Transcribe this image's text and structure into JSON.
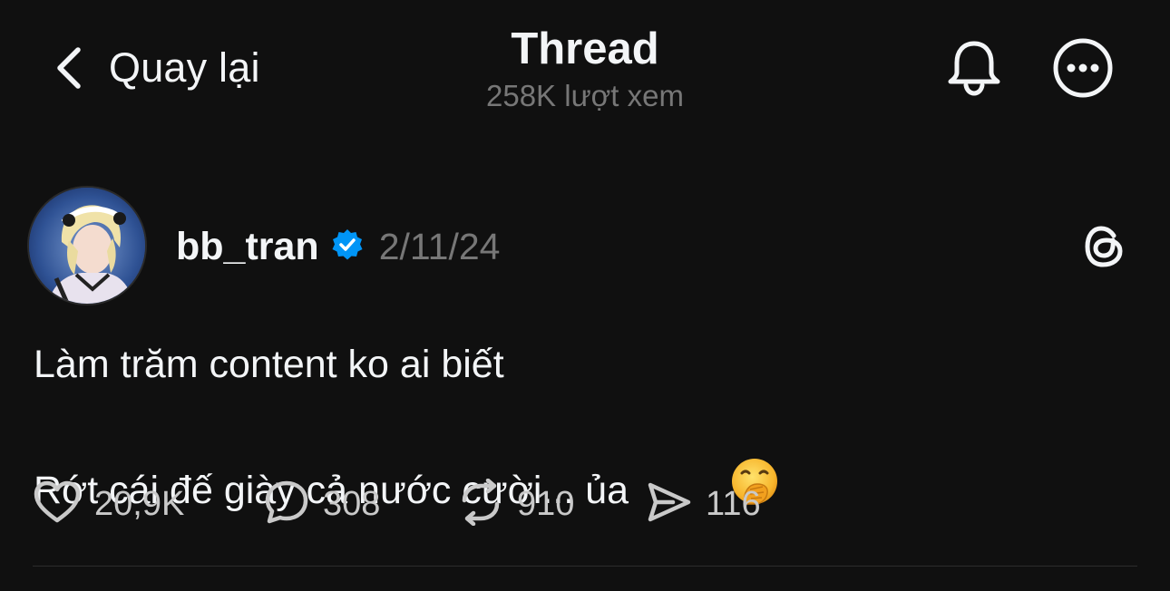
{
  "header": {
    "back_label": "Quay lại",
    "title": "Thread",
    "views": "258K lượt xem",
    "icons": [
      "chevron-left-icon",
      "bell-icon",
      "more-icon"
    ]
  },
  "post": {
    "username": "bb_tran",
    "verified": true,
    "date": "2/11/24",
    "text_lines": [
      "Làm trăm content ko ai biết",
      "Rớt cái đế giày cả nước cười... ủa"
    ],
    "emoji": "face-with-hand-over-mouth",
    "stats": {
      "likes": "20,9K",
      "replies": "308",
      "reposts": "910",
      "shares": "116"
    }
  },
  "colors": {
    "background": "#101010",
    "primary_text": "#f3f5f7",
    "secondary_text": "#777777",
    "verified_blue": "#0095f6"
  }
}
